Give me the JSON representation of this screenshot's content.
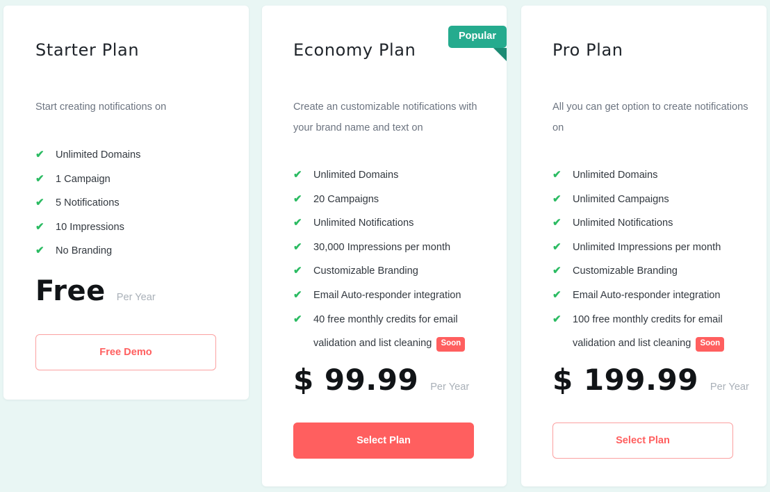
{
  "theme": {
    "page_background": "#e9f6f4",
    "card_background": "#ffffff",
    "accent_red": "#ff5f5f",
    "accent_teal": "#25ab8e",
    "check_green": "#2bbb62",
    "soon_badge_color": "#ff5f5f"
  },
  "plans": [
    {
      "id": "starter",
      "title": "Starter Plan",
      "description": "Start creating notifications on",
      "features": [
        {
          "text": "Unlimited Domains",
          "badge": null
        },
        {
          "text": "1 Campaign",
          "badge": null
        },
        {
          "text": "5 Notifications",
          "badge": null
        },
        {
          "text": "10 Impressions",
          "badge": null
        },
        {
          "text": "No Branding",
          "badge": null
        }
      ],
      "price": "Free",
      "period": "Per Year",
      "cta_label": "Free Demo",
      "cta_style": "outline",
      "badge": null
    },
    {
      "id": "economy",
      "title": "Economy Plan",
      "description": "Create an customizable notifications with your brand name and text on",
      "features": [
        {
          "text": "Unlimited Domains",
          "badge": null
        },
        {
          "text": "20 Campaigns",
          "badge": null
        },
        {
          "text": "Unlimited Notifications",
          "badge": null
        },
        {
          "text": "30,000 Impressions per month",
          "badge": null
        },
        {
          "text": "Customizable Branding",
          "badge": null
        },
        {
          "text": "Email Auto-responder integration",
          "badge": null
        },
        {
          "text": "40 free monthly credits for email validation and list cleaning",
          "badge": "Soon"
        }
      ],
      "price": "$ 99.99",
      "period": "Per Year",
      "cta_label": "Select Plan",
      "cta_style": "filled",
      "badge": "Popular"
    },
    {
      "id": "pro",
      "title": "Pro Plan",
      "description": "All you can get option to create notifications on",
      "features": [
        {
          "text": "Unlimited Domains",
          "badge": null
        },
        {
          "text": "Unlimited Campaigns",
          "badge": null
        },
        {
          "text": "Unlimited Notifications",
          "badge": null
        },
        {
          "text": "Unlimited Impressions per month",
          "badge": null
        },
        {
          "text": "Customizable Branding",
          "badge": null
        },
        {
          "text": "Email Auto-responder integration",
          "badge": null
        },
        {
          "text": "100 free monthly credits for email validation and list cleaning",
          "badge": "Soon"
        }
      ],
      "price": "$ 199.99",
      "period": "Per Year",
      "cta_label": "Select Plan",
      "cta_style": "outline",
      "badge": null
    }
  ],
  "icons": {
    "check": "✔"
  }
}
